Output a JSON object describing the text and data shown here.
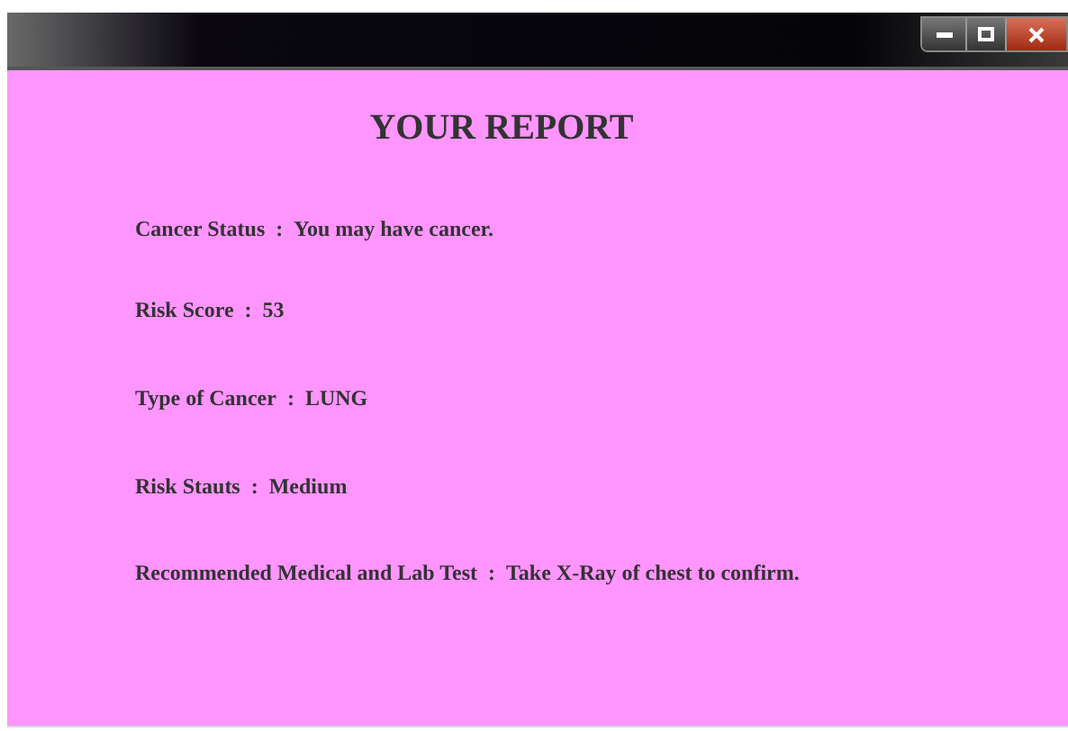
{
  "report": {
    "heading": "YOUR REPORT",
    "rows": [
      {
        "label": "Cancer Status",
        "separator": ":",
        "value": "You may have cancer."
      },
      {
        "label": "Risk Score",
        "separator": ":",
        "value": "53"
      },
      {
        "label": "Type of Cancer",
        "separator": ":",
        "value": "LUNG"
      },
      {
        "label": "Risk Stauts",
        "separator": ":",
        "value": "Medium"
      },
      {
        "label": "Recommended Medical and Lab Test",
        "separator": ":",
        "value": "Take X-Ray of chest to confirm."
      }
    ]
  }
}
